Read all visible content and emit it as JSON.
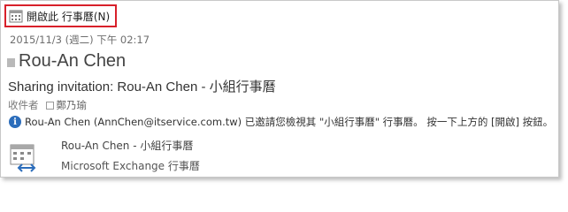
{
  "toolbar": {
    "open_label": "開啟此 行事曆(N)",
    "open_icon": "calendar-icon",
    "highlight_color": "#d8202a"
  },
  "message": {
    "date": "2015/11/3 (週二) 下午 02:17",
    "sender": "Rou-An Chen",
    "subject": "Sharing invitation: Rou-An Chen - 小組行事曆",
    "recipients_label": "收件者",
    "recipient": "鄭乃瑜",
    "info_text": "Rou-An Chen (AnnChen@itservice.com.tw) 已邀請您檢視其 \"小組行事曆\" 行事曆。 按一下上方的 [開啟] 按鈕。",
    "info_icon": "info-icon"
  },
  "calendar_card": {
    "title": "Rou-An Chen - 小組行事曆",
    "subtitle": "Microsoft Exchange 行事曆",
    "icon": "shared-calendar-icon",
    "accent_color": "#2c6dbb"
  }
}
